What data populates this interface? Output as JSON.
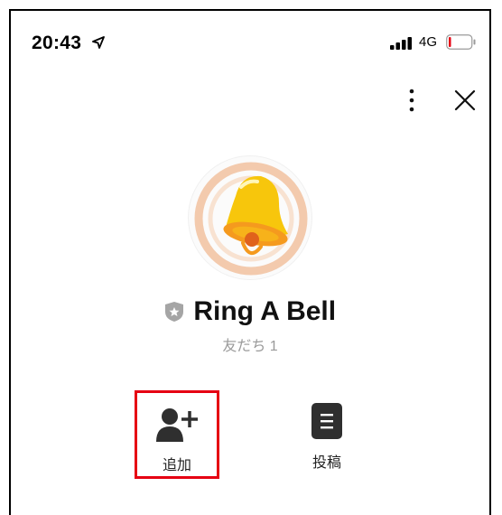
{
  "status_bar": {
    "time": "20:43",
    "network": "4G"
  },
  "header": {
    "more_icon": "more-vertical-icon",
    "close_icon": "close-icon"
  },
  "profile": {
    "name": "Ring A Bell",
    "friends": "友だち 1",
    "badge_icon": "shield-star-icon"
  },
  "actions": [
    {
      "label": "追加",
      "icon": "add-friend-icon",
      "highlight": "#e60012"
    },
    {
      "label": "投稿",
      "icon": "post-icon"
    }
  ],
  "colors": {
    "bell_yellow": "#f7c60c",
    "bell_orange": "#f59a1e",
    "ring_peach": "#f2c4a4",
    "badge_gray": "#a5a5a5"
  }
}
